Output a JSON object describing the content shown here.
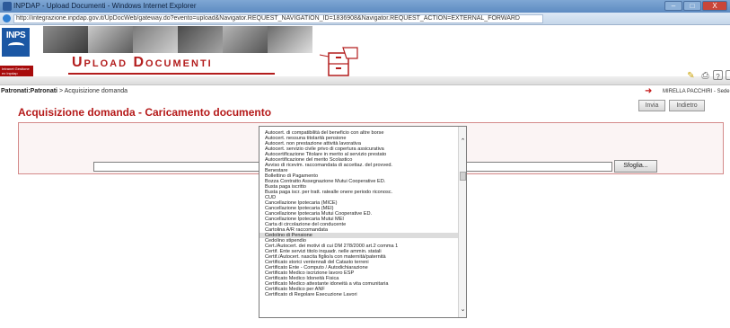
{
  "window": {
    "title": "INPDAP - Upload Documenti - Windows Internet Explorer",
    "url": "http://integrazione.inpdap.gov.it/UpDocWeb/gateway.do?evento=upload&Navigator.REQUEST_NAVIGATION_ID=1836908&Navigator.REQUEST_ACTION=EXTERNAL_FORWARD",
    "controls": [
      "–",
      "□",
      "X"
    ]
  },
  "header": {
    "logo_text": "INPS",
    "app_title": "Upload Documenti",
    "redstrip_text": "Intranet Gestione ex Inpdap"
  },
  "toolbar": {
    "icons": [
      "pencil-icon",
      "print-icon",
      "help-icon",
      "info-icon"
    ],
    "help_label": "?",
    "info_label": "i"
  },
  "breadcrumb": {
    "root": "Patronati:Patronati",
    "separator": " > ",
    "current": "Acquisizione domanda"
  },
  "user": {
    "name": "MIRELLA PACCHIRI - Sede"
  },
  "buttons": {
    "invia": "Invia",
    "indietro": "Indietro",
    "sfoglia": "Sfoglia..."
  },
  "page_title": "Acquisizione domanda - Caricamento documento",
  "dropdown": {
    "selected": "Cedolino di Pensione",
    "options": [
      "Autocert. di compatibilità del beneficio con altre borse",
      "Autocert. nessuna titolarità pensione",
      "Autocert. non prestazione attività lavorativa",
      "Autocert. servizio civile privo di copertura assicurativa",
      "Autocertificazione Titolare in merito al servizio prestato",
      "Autocertificazione del merito Scolastico",
      "Avviso di ricevim. raccomandata di accettaz. del provved.",
      "Benestare",
      "Bollettino di Pagamento",
      "Bozza Contratto Assegnazione Mutui Cooperative ED.",
      "Busta paga iscritto",
      "Busta paga iscr. per tratt. ratealle onere periodo riconosc.",
      "CUD",
      "Cancellazione Ipotecaria (MICE)",
      "Cancellazione Ipotecaria (MEI)",
      "Cancellazione Ipotecaria Mutui Cooperative ED.",
      "Cancellazione Ipotecaria Mutui MEI",
      "Carta di circolazione del conducente",
      "Cartolina A/R raccomandata",
      "Cedolino di Pensione",
      "Cedolino stipendio",
      "Cert./Autocert. dei motivi di cui DM 278/2000 art.2 comma 1",
      "Certif. Ente servizi titolo inquadr. nelle ammin. statali",
      "Certif./Autocert. nascita figlio/a con maternità/paternità",
      "Certificato storici ventennali del Catasto terreni",
      "Certificato Ente - Computo / Autodichiarazione",
      "Certificato Medico iscrizione lavoro ESP",
      "Certificato Medico Idoneità Fisica",
      "Certificato Medico attestante idoneità a vita comunitaria",
      "Certificato Medico per ANF",
      "Certificato di Regolare Esecuzione Lavori"
    ]
  },
  "colors": {
    "brand_red": "#b31d1d",
    "inps_blue": "#1b57a4",
    "selection_bg": "#dcdcdc"
  }
}
